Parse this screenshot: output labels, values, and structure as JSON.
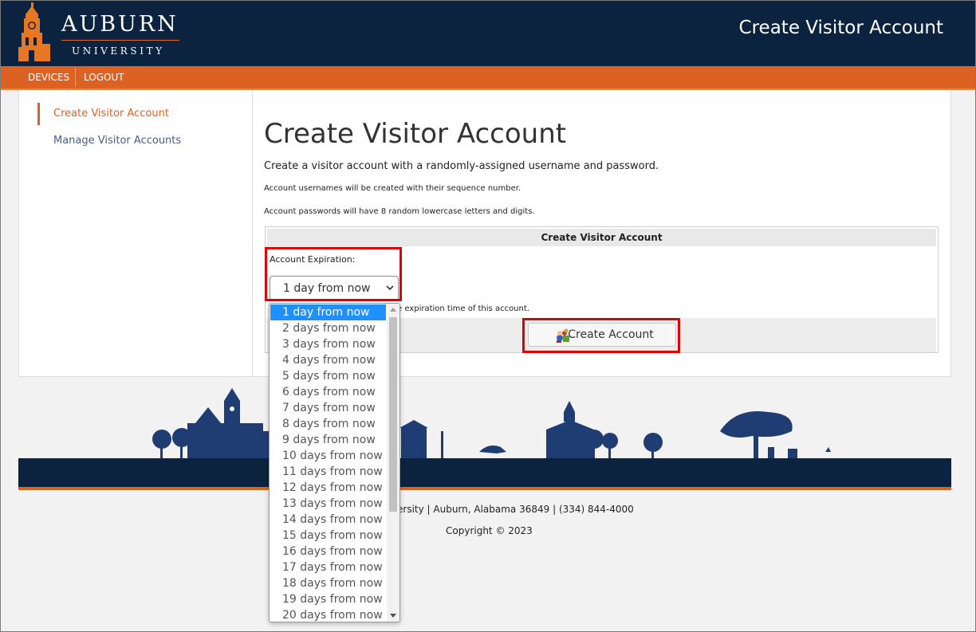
{
  "header": {
    "logo_line1": "AUBURN",
    "logo_line2": "UNIVERSITY",
    "page_title": "Create Visitor Account"
  },
  "nav": {
    "items": [
      {
        "label": "DEVICES"
      },
      {
        "label": "LOGOUT"
      }
    ]
  },
  "sidebar": {
    "items": [
      {
        "label": "Create Visitor Account",
        "active": true
      },
      {
        "label": "Manage Visitor Accounts",
        "active": false
      }
    ]
  },
  "main": {
    "title": "Create Visitor Account",
    "description": "Create a visitor account with a randomly-assigned username and password.",
    "note1": "Account usernames will be created with their sequence number.",
    "note2": "Account passwords will have 8 random lowercase letters and digits.",
    "form": {
      "header": "Create Visitor Account",
      "expiration_label": "Account Expiration:",
      "selected_value": "1 day from now",
      "help_text_visible": "e expiration time of this account.",
      "submit_label": "Create Account"
    }
  },
  "dropdown": {
    "options": [
      "1 day from now",
      "2 days from now",
      "3 days from now",
      "4 days from now",
      "5 days from now",
      "6 days from now",
      "7 days from now",
      "8 days from now",
      "9 days from now",
      "10 days from now",
      "11 days from now",
      "12 days from now",
      "13 days from now",
      "14 days from now",
      "15 days from now",
      "16 days from now",
      "17 days from now",
      "18 days from now",
      "19 days from now",
      "20 days from now"
    ],
    "selected_index": 0
  },
  "footer": {
    "address_visible": "ersity | Auburn, Alabama 36849 | (334) 844-4000",
    "copyright": "Copyright © 2023"
  },
  "colors": {
    "navy": "#0c2340",
    "orange": "#dd6222",
    "sidebar_active": "#dd6222",
    "sidebar_link": "#4a5b8c",
    "highlight": "#e00000",
    "option_selected": "#1e90ff"
  }
}
